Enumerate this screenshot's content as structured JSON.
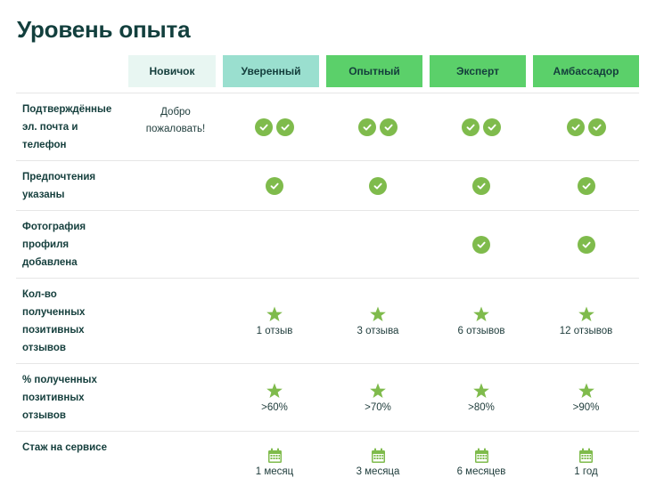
{
  "title": "Уровень опыта",
  "levels": [
    {
      "label": "Новичок",
      "color": "#e8f6f2"
    },
    {
      "label": "Уверенный",
      "color": "#9adfcf"
    },
    {
      "label": "Опытный",
      "color": "#5bd06a"
    },
    {
      "label": "Эксперт",
      "color": "#5bd06a"
    },
    {
      "label": "Амбассадор",
      "color": "#5bd06a"
    }
  ],
  "rows": {
    "verified": {
      "label": [
        "Подтверждённые",
        "эл. почта и",
        "телефон"
      ],
      "novice": [
        "Добро",
        "пожаловать!"
      ]
    },
    "preferences": {
      "label": [
        "Предпочтения",
        "указаны"
      ]
    },
    "photo": {
      "label": [
        "Фотография",
        "профиля",
        "добавлена"
      ]
    },
    "reviews": {
      "label": [
        "Кол-во",
        "полученных",
        "позитивных",
        "отзывов"
      ],
      "values": [
        "1 отзыв",
        "3 отзыва",
        "6 отзывов",
        "12 отзывов"
      ]
    },
    "percent": {
      "label": [
        "% полученных",
        "позитивных",
        "отзывов"
      ],
      "values": [
        ">60%",
        ">70%",
        ">80%",
        ">90%"
      ]
    },
    "tenure": {
      "label": [
        "Стаж на сервисе"
      ],
      "values": [
        "1 месяц",
        "3 месяца",
        "6 месяцев",
        "1 год"
      ]
    }
  },
  "icons": {
    "check": "check-circle-icon",
    "star": "star-icon",
    "calendar": "calendar-icon"
  },
  "accent_color": "#7fbb4c"
}
